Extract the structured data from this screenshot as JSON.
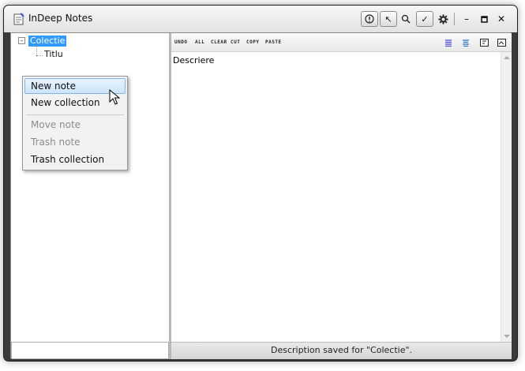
{
  "window": {
    "title": "InDeep Notes",
    "controls": {
      "info_icon": "!",
      "pointer_icon": "↖",
      "search_icon": "⚲",
      "check_icon": "✓",
      "gear_icon": "✲",
      "minimize": "–",
      "maximize": "▫",
      "close": "✕"
    }
  },
  "tree": {
    "expander": "–",
    "root_label": "Colectie",
    "children": [
      {
        "label": "Titlu"
      }
    ]
  },
  "editor_toolbar": {
    "buttons": [
      "UNDO",
      "ALL",
      "CLEAR",
      "CUT",
      "COPY",
      "PASTE"
    ],
    "right_icons": [
      "align-left-icon",
      "align-center-icon",
      "text-box-icon",
      "image-box-icon"
    ],
    "accent_color": "#4a4ad6"
  },
  "editor": {
    "content": "Descriere"
  },
  "status_bar": {
    "text": "Description saved for \"Colectie\"."
  },
  "context_menu": {
    "items": [
      {
        "label": "New note",
        "enabled": true,
        "highlighted": true
      },
      {
        "label": "New collection",
        "enabled": true
      },
      {
        "label": "Move note",
        "enabled": false
      },
      {
        "label": "Trash note",
        "enabled": false
      },
      {
        "label": "Trash collection",
        "enabled": true
      }
    ]
  },
  "colors": {
    "selection": "#3399ff",
    "menu_hover": "#cbe4fb",
    "disabled_text": "#8c8c8c"
  }
}
